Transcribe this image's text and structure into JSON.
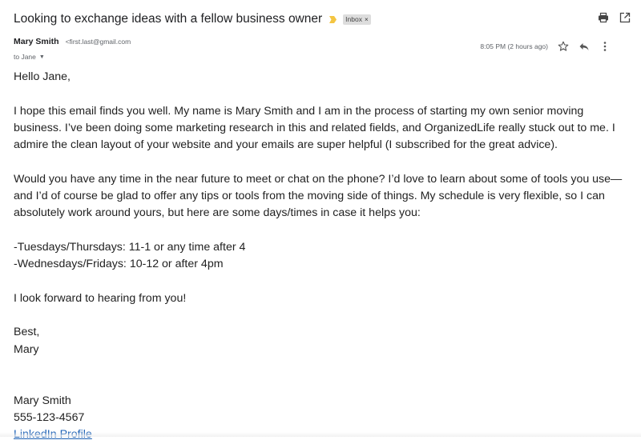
{
  "header": {
    "subject": "Looking to exchange ideas with a fellow business owner",
    "label_chip": "Inbox",
    "label_chip_remove": "×",
    "accent_color": "#f4c542",
    "icons": [
      "print-icon",
      "open-in-new-window-icon"
    ]
  },
  "sender": {
    "name": "Mary Smith",
    "email": "<first.last@gmail.com",
    "to_label": "to Jane",
    "caret": "▼"
  },
  "meta": {
    "timestamp": "8:05 PM (2 hours ago)",
    "icons": [
      "star-icon",
      "reply-icon",
      "more-options-icon"
    ]
  },
  "body": {
    "greeting": "Hello Jane,",
    "paragraph1": "I hope this email finds you well. My name is Mary Smith and I am in the process of starting my own senior moving business. I’ve been doing some marketing research in this and related fields, and OrganizedLife really stuck out to me. I admire the clean layout of your website and your emails are super helpful (I subscribed for the great advice).",
    "paragraph2": "Would you have any time in the near future to meet or chat on the phone? I’d love to learn about some of tools you use—and I’d of course be glad to offer any tips or tools from the moving side of things. My schedule is very flexible, so I can absolutely work around yours, but here are some days/times in case it helps you:",
    "schedule_line1": "-Tuesdays/Thursdays: 11-1 or any time after 4",
    "schedule_line2": "-Wednesdays/Fridays: 10-12 or after 4pm",
    "closing_line": "I look forward to hearing from you!",
    "signoff": "Best,",
    "signoff_name": "Mary",
    "signature_name": "Mary Smith",
    "signature_phone": "555-123-4567",
    "signature_link": "LinkedIn Profile",
    "link_color": "#1a5fb4"
  }
}
